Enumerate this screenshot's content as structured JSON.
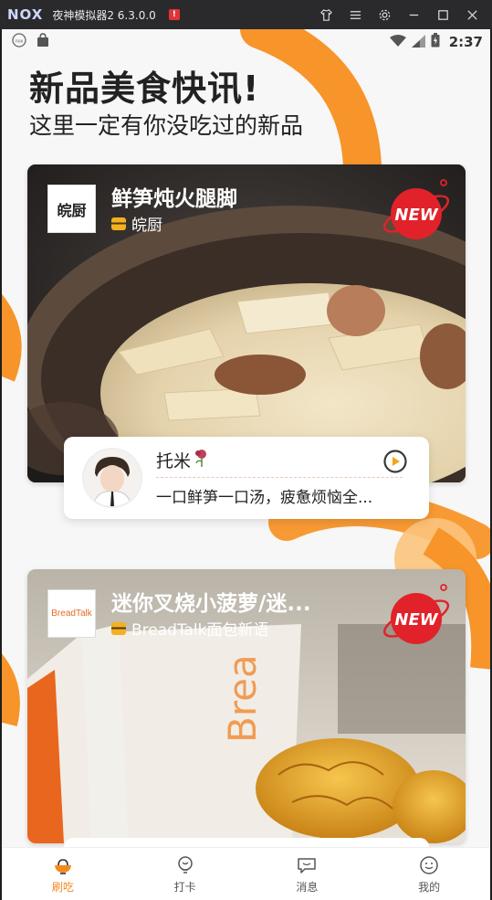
{
  "emulator": {
    "logo_text": "NOX",
    "title": "夜神模拟器2 6.3.0.0",
    "warn": "!"
  },
  "status_bar": {
    "time": "2:37"
  },
  "header": {
    "title": "新品美食快讯!",
    "subtitle": "这里一定有你没吃过的新品"
  },
  "cards": [
    {
      "title": "鲜笋炖火腿脚",
      "store": "皖厨",
      "logo_text": "皖厨",
      "badge": "NEW",
      "comment": {
        "user": "托米",
        "text": "一口鲜笋一口汤，疲惫烦恼全..."
      }
    },
    {
      "title": "迷你叉烧小菠萝/迷...",
      "store": "BreadTalk面包新语",
      "logo_text": "BreadTalk",
      "badge": "NEW"
    }
  ],
  "bottom_nav": {
    "items": [
      {
        "label": "刷吃",
        "icon": "bowl-icon",
        "active": true
      },
      {
        "label": "打卡",
        "icon": "bulb-icon",
        "active": false
      },
      {
        "label": "消息",
        "icon": "chat-icon",
        "active": false
      },
      {
        "label": "我的",
        "icon": "smile-icon",
        "active": false
      }
    ]
  },
  "colors": {
    "accent": "#f28a1e",
    "badge_red": "#e1222a"
  }
}
